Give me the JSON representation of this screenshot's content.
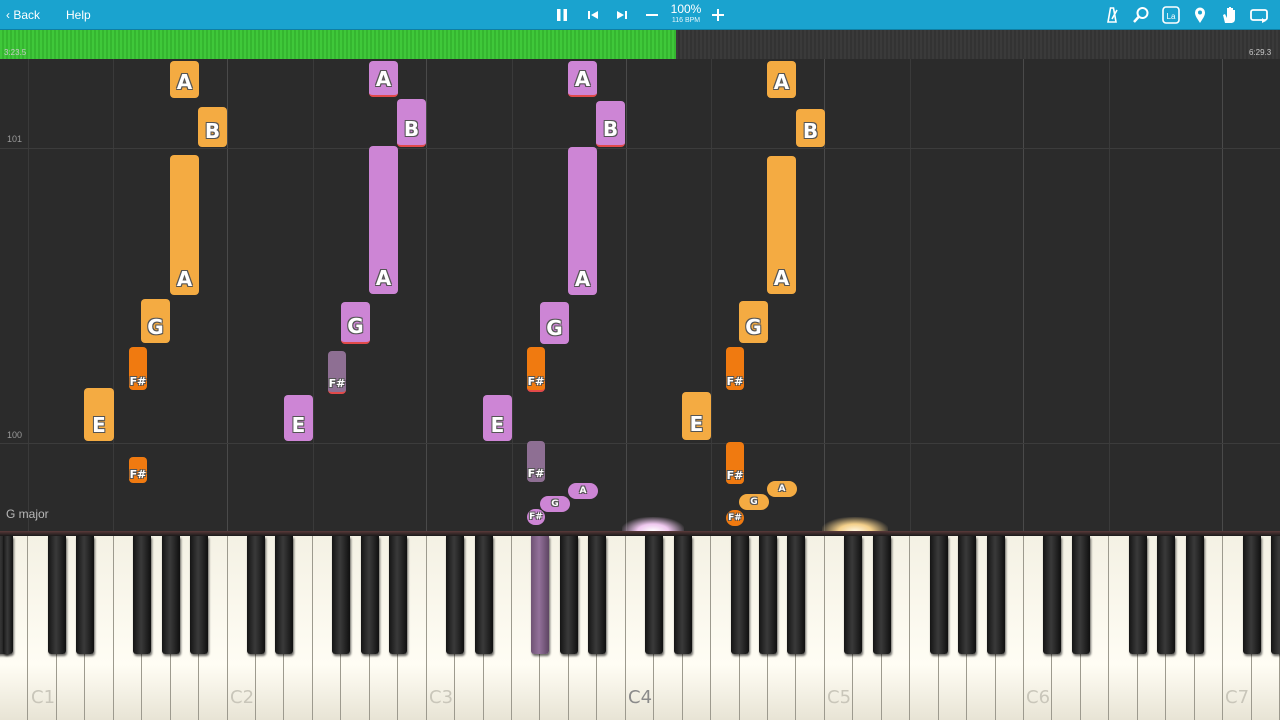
{
  "toolbar": {
    "back_label": "Back",
    "help_label": "Help",
    "zoom": "100%",
    "tempo": "116 BPM",
    "icons": [
      "pause-icon",
      "previous-icon",
      "next-icon",
      "minus-icon",
      "plus-icon",
      "metronome-icon",
      "search-icon",
      "sheet-icon",
      "marker-icon",
      "hand-icon",
      "loop-icon"
    ]
  },
  "progress": {
    "elapsed": "3:23.5",
    "total": "6:29.3",
    "fraction": 0.528
  },
  "roll": {
    "key_signature": "G major",
    "measure_labels": [
      "101",
      "100"
    ]
  },
  "notes": [
    {
      "label": "A",
      "color": "yellow"
    },
    {
      "label": "B",
      "color": "yellow"
    },
    {
      "label": "A",
      "color": "yellow"
    },
    {
      "label": "G",
      "color": "yellow"
    },
    {
      "label": "F#",
      "color": "orange"
    },
    {
      "label": "E",
      "color": "yellow"
    },
    {
      "label": "F#",
      "color": "orange"
    },
    {
      "label": "A",
      "color": "purple"
    },
    {
      "label": "B",
      "color": "purple"
    },
    {
      "label": "A",
      "color": "purple"
    },
    {
      "label": "G",
      "color": "purple"
    },
    {
      "label": "F#",
      "color": "gray"
    },
    {
      "label": "E",
      "color": "purple"
    },
    {
      "label": "A",
      "color": "purple"
    },
    {
      "label": "B",
      "color": "purple"
    },
    {
      "label": "A",
      "color": "purple"
    },
    {
      "label": "G",
      "color": "purple"
    },
    {
      "label": "F#",
      "color": "orange"
    },
    {
      "label": "E",
      "color": "purple"
    },
    {
      "label": "F#",
      "color": "gray"
    },
    {
      "label": "A",
      "color": "purple"
    },
    {
      "label": "G",
      "color": "purple"
    },
    {
      "label": "F#",
      "color": "purple"
    },
    {
      "label": "A",
      "color": "yellow"
    },
    {
      "label": "B",
      "color": "yellow"
    },
    {
      "label": "A",
      "color": "yellow"
    },
    {
      "label": "G",
      "color": "yellow"
    },
    {
      "label": "F#",
      "color": "orange"
    },
    {
      "label": "E",
      "color": "yellow"
    },
    {
      "label": "F#",
      "color": "orange"
    },
    {
      "label": "A",
      "color": "yellow"
    },
    {
      "label": "G",
      "color": "yellow"
    },
    {
      "label": "F#",
      "color": "orange"
    }
  ],
  "keyboard": {
    "octave_labels": [
      "C1",
      "C2",
      "C3",
      "C4",
      "C5",
      "C6",
      "C7"
    ]
  },
  "colors": {
    "toolbar": "#1aa3cf",
    "progress_fill": "#3fc83a",
    "yellow": "#f4ab42",
    "orange": "#f07a10",
    "purple": "#cd85d5",
    "gray": "#8e6f93"
  }
}
